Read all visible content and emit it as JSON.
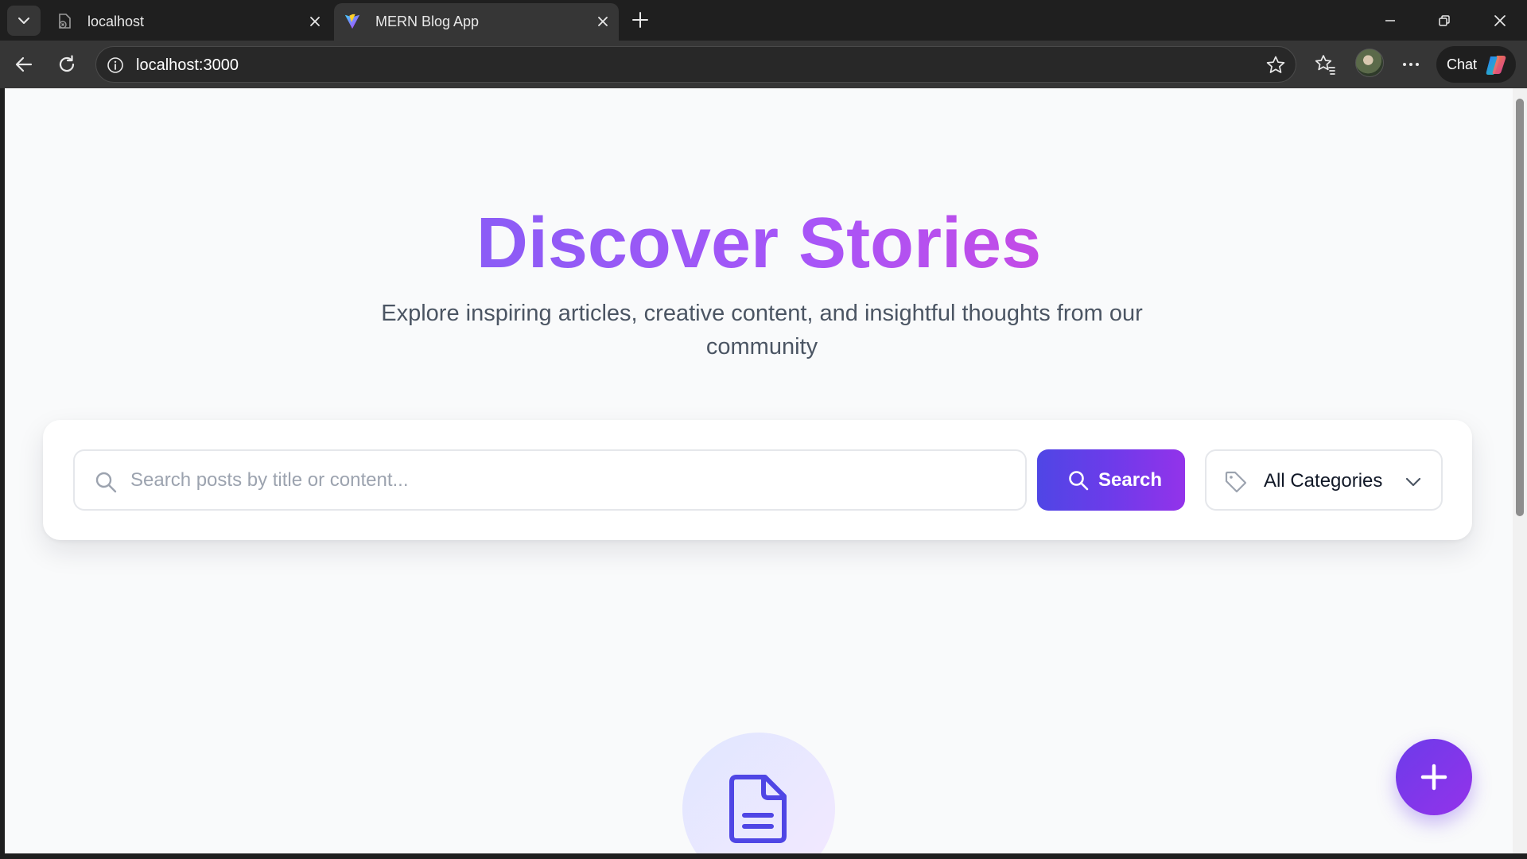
{
  "browser": {
    "tabs": [
      {
        "title": "localhost",
        "active": false
      },
      {
        "title": "MERN Blog App",
        "active": true
      }
    ],
    "address": "localhost:3000",
    "chat_label": "Chat"
  },
  "page": {
    "hero": {
      "title": "Discover Stories",
      "subtitle": "Explore inspiring articles, creative content, and insightful thoughts from our community"
    },
    "search": {
      "placeholder": "Search posts by title or content...",
      "value": "",
      "button_label": "Search"
    },
    "category": {
      "selected": "All Categories"
    },
    "icons": {
      "search": "search-icon",
      "category": "tag-icon",
      "dropdown": "chevron-down-icon",
      "empty_state": "document-icon",
      "fab": "plus-icon"
    },
    "colors": {
      "accent_start": "#4f46e5",
      "accent_end": "#9333ea",
      "title_gradient_start": "#8b5cf6",
      "title_gradient_end": "#c44be6",
      "page_background": "#f9fafb"
    }
  }
}
